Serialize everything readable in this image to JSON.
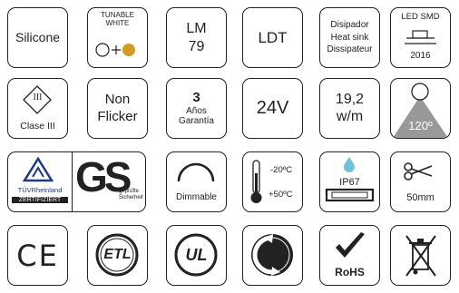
{
  "row1": {
    "silicone": "Silicone",
    "tunable_line1": "TUNABLE",
    "tunable_line2": "WHITE",
    "lm_line1": "LM",
    "lm_line2": "79",
    "ldt": "LDT",
    "dis_line1": "Disipador",
    "dis_line2": "Heat sink",
    "dis_line3": "Dissipateur",
    "smd_title": "LED SMD",
    "smd_model": "2016"
  },
  "row2": {
    "clase_symbol": "III",
    "clase_label": "Clase III",
    "flicker_line1": "Non",
    "flicker_line2": "Flicker",
    "warranty_number": "3",
    "warranty_line1": "Años",
    "warranty_line2": "Garantía",
    "voltage": "24V",
    "power_line1": "19,2",
    "power_line2": "w/m",
    "beam_angle": "120º"
  },
  "row3": {
    "tuv_line1": "TÜVRheinland",
    "tuv_line2": "ZERTIFIZIERT",
    "gs_letters": "GS",
    "gs_line1": "geprüfte",
    "gs_line2": "Sicherheit",
    "dimmable": "Dimmable",
    "temp_high": "-20ºC",
    "temp_low": "+50ºC",
    "ip_rating": "IP67",
    "cut_length": "50mm"
  },
  "row4": {
    "ce_mark": "CE",
    "etl_mark": "ETL",
    "ul_mark": "UL",
    "rohs_label": "RoHS"
  },
  "colors": {
    "border": "#222222",
    "warm_dot": "#d29a1e",
    "beam_gray": "#999999",
    "water_drop": "#6fc3d8",
    "tuv_blue": "#1d3a8a"
  }
}
